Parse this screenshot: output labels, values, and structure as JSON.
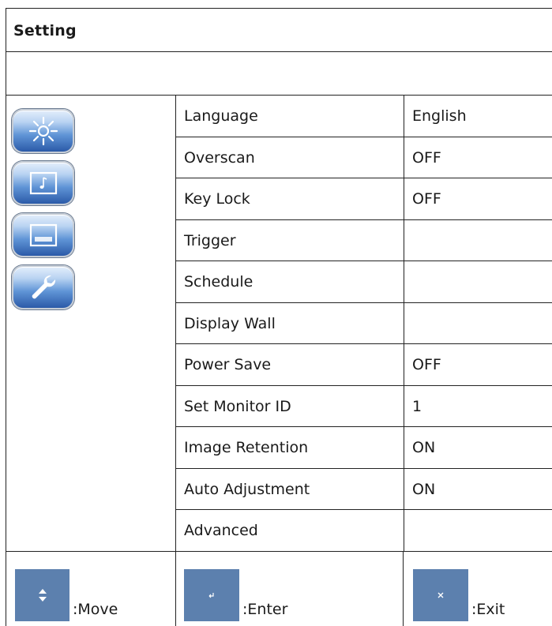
{
  "header": {
    "title": "Setting"
  },
  "category_icons": [
    "brightness-icon",
    "audio-icon",
    "window-icon",
    "wrench-icon"
  ],
  "menu": [
    {
      "label": "Language",
      "value": "English"
    },
    {
      "label": "Overscan",
      "value": "OFF"
    },
    {
      "label": "Key Lock",
      "value": "OFF"
    },
    {
      "label": "Trigger",
      "value": ""
    },
    {
      "label": "Schedule",
      "value": ""
    },
    {
      "label": "Display Wall",
      "value": ""
    },
    {
      "label": "Power Save",
      "value": "OFF"
    },
    {
      "label": "Set Monitor ID",
      "value": "1"
    },
    {
      "label": "Image Retention",
      "value": "ON"
    },
    {
      "label": "Auto Adjustment",
      "value": "ON"
    },
    {
      "label": "Advanced",
      "value": ""
    }
  ],
  "footer": {
    "move": {
      "label": ":Move",
      "icon": "up-down-arrows-icon"
    },
    "enter": {
      "label": ":Enter",
      "icon": "enter-icon"
    },
    "exit": {
      "label": ":Exit",
      "icon": "close-icon"
    }
  },
  "colors": {
    "key_bg": "#5c80ae",
    "icon_blue": "#2b5aa8",
    "border": "#222222"
  }
}
